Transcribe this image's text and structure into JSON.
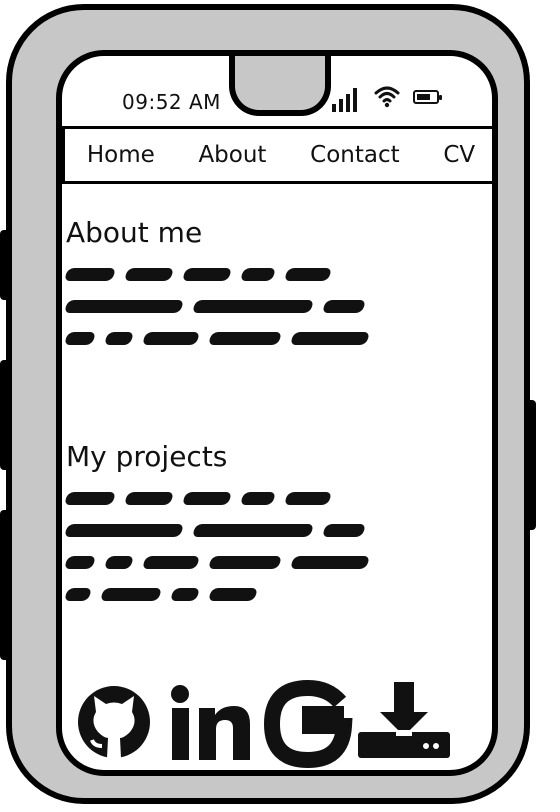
{
  "status_bar": {
    "time": "09:52 AM",
    "battery_level": 0.7,
    "signal_bars": 4
  },
  "nav": {
    "items": [
      "Home",
      "About",
      "Contact",
      "CV"
    ]
  },
  "sections": [
    {
      "heading": "About me",
      "scribble_lines": [
        5,
        3,
        5
      ]
    },
    {
      "heading": "My projects",
      "scribble_lines": [
        5,
        3,
        5,
        4
      ]
    }
  ],
  "footer_icons": [
    "github-icon",
    "linkedin-icon",
    "google-icon",
    "download-icon"
  ],
  "colors": {
    "frame": "#c7c7c7",
    "ink": "#000000",
    "screen": "#ffffff"
  }
}
